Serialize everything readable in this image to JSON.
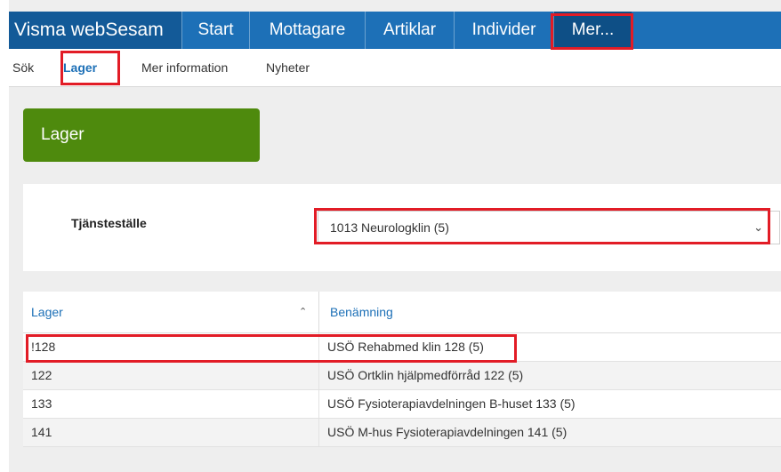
{
  "app": {
    "brand": "Visma webSesam"
  },
  "topnav": {
    "items": [
      "Start",
      "Mottagare",
      "Artiklar",
      "Individer",
      "Mer..."
    ]
  },
  "subnav": {
    "items": [
      "Sök",
      "Lager",
      "Mer information",
      "Nyheter"
    ],
    "active": "Lager"
  },
  "page": {
    "title": "Lager"
  },
  "form": {
    "label": "Tjänsteställe",
    "selected_value": "1013 Neurologklin (5)"
  },
  "table": {
    "columns": [
      "Lager",
      "Benämning"
    ],
    "rows": [
      {
        "lager": "!128",
        "benamning": "USÖ Rehabmed klin 128 (5)"
      },
      {
        "lager": "122",
        "benamning": "USÖ Ortklin hjälpmedförråd 122 (5)"
      },
      {
        "lager": "133",
        "benamning": "USÖ Fysioterapiavdelningen B-huset 133 (5)"
      },
      {
        "lager": "141",
        "benamning": "USÖ M-hus Fysioterapiavdelningen 141 (5)"
      }
    ]
  },
  "colors": {
    "nav_blue": "#1d70b7",
    "brand_blue": "#135a98",
    "title_green": "#4e8a0d",
    "highlight_red": "#e21c26"
  }
}
